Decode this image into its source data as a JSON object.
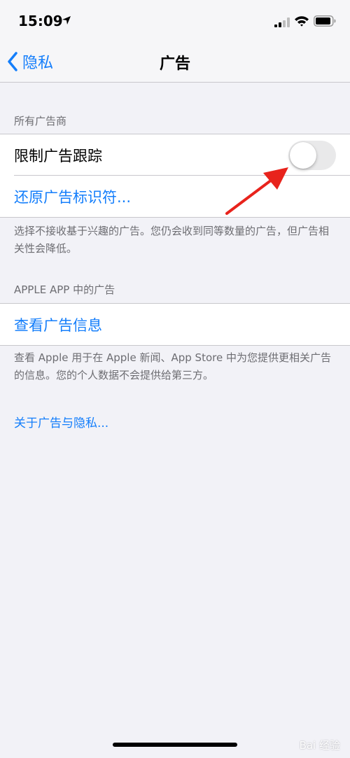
{
  "status_bar": {
    "time": "15:09"
  },
  "nav": {
    "back_label": "隐私",
    "title": "广告"
  },
  "section_all_advertisers": {
    "header": "所有广告商",
    "limit_tracking_label": "限制广告跟踪",
    "limit_tracking_enabled": false,
    "reset_identifier_label": "还原广告标识符...",
    "footer": "选择不接收基于兴趣的广告。您仍会收到同等数量的广告，但广告相关性会降低。"
  },
  "section_apple_app": {
    "header": "APPLE APP 中的广告",
    "view_info_label": "查看广告信息",
    "footer": "查看 Apple 用于在 Apple 新闻、App Store 中为您提供更相关广告的信息。您的个人数据不会提供给第三方。"
  },
  "about_link": "关于广告与隐私...",
  "watermark": "Bai 经验",
  "colors": {
    "accent": "#147efb",
    "background": "#f2f2f7",
    "annotation": "#e8231c"
  },
  "icons": {
    "location": "location-arrow-icon",
    "signal": "cellular-signal-icon",
    "wifi": "wifi-icon",
    "battery": "battery-icon",
    "back": "chevron-left-icon"
  }
}
